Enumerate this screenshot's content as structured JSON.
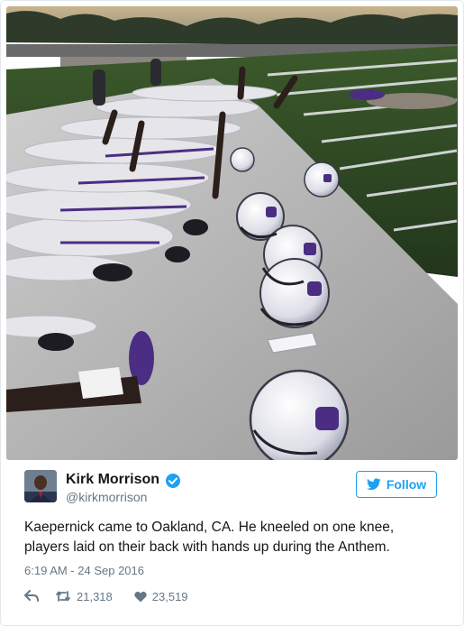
{
  "tweet": {
    "author_name": "Kirk Morrison",
    "author_handle": "@kirkmorrison",
    "verified": true,
    "follow_label": "Follow",
    "text_lines": [
      "Kaepernick came to Oakland, CA. He kneeled on one knee,",
      "players laid on their back with hands up during the Anthem."
    ],
    "timestamp": "6:19 AM - 24 Sep 2016",
    "retweet_count": "21,318",
    "like_count": "23,519"
  },
  "photo": {
    "description": "football-players-lying-on-field-with-helmets"
  },
  "colors": {
    "accent": "#1da1f2",
    "text": "#14171a",
    "muted": "#657786",
    "border": "#e1e8ed",
    "team_purple": "#4b2e83",
    "turf_green": "#2f4a26"
  },
  "icons": [
    "verified-badge-icon",
    "twitter-bird-icon",
    "reply-icon",
    "retweet-icon",
    "heart-icon"
  ]
}
